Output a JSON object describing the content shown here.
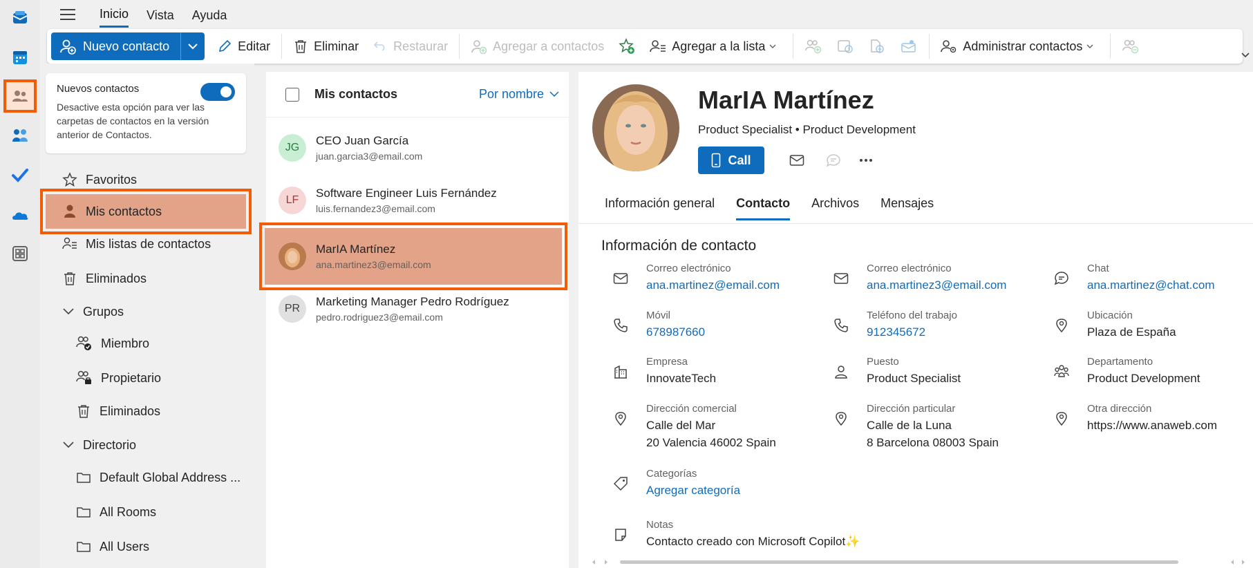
{
  "rail": {
    "items": [
      {
        "name": "mail-icon"
      },
      {
        "name": "calendar-icon"
      },
      {
        "name": "people-icon"
      },
      {
        "name": "groups-icon"
      },
      {
        "name": "todo-icon"
      },
      {
        "name": "onedrive-icon"
      },
      {
        "name": "apps-icon"
      }
    ]
  },
  "menu": {
    "tabs": [
      "Inicio",
      "Vista",
      "Ayuda"
    ],
    "active": "Inicio"
  },
  "toolbar": {
    "new_contact": "Nuevo contacto",
    "edit": "Editar",
    "delete": "Eliminar",
    "restore": "Restaurar",
    "add_to_contacts": "Agregar a contactos",
    "add_to_list": "Agregar a la lista",
    "manage_contacts": "Administrar contactos"
  },
  "leftnav": {
    "toggle_title": "Nuevos contactos",
    "toggle_desc": "Desactive esta opción para ver las carpetas de contactos en la versión anterior de Contactos.",
    "toggle_on": true,
    "favorites": "Favoritos",
    "my_contacts": "Mis contactos",
    "my_lists": "Mis listas de contactos",
    "deleted": "Eliminados",
    "groups": "Grupos",
    "member": "Miembro",
    "owner": "Propietario",
    "groups_deleted": "Eliminados",
    "directory": "Directorio",
    "dir_global": "Default Global Address ...",
    "dir_rooms": "All Rooms",
    "dir_users": "All Users"
  },
  "list": {
    "title": "Mis contactos",
    "sort": "Por nombre",
    "contacts": [
      {
        "initials": "JG",
        "name": "CEO Juan García",
        "email": "juan.garcia3@email.com",
        "bg": "#c8efd4",
        "fg": "#2f7a45"
      },
      {
        "initials": "LF",
        "name": "Software Engineer Luis Fernández",
        "email": "luis.fernandez3@email.com",
        "bg": "#f7d6d6",
        "fg": "#a33a3a"
      },
      {
        "initials": "",
        "name": "MarIA Martínez",
        "email": "ana.martinez3@email.com",
        "bg": "#c98b5e",
        "fg": "#fff"
      },
      {
        "initials": "PR",
        "name": "Marketing Manager Pedro Rodríguez",
        "email": "pedro.rodriguez3@email.com",
        "bg": "#e0e0e0",
        "fg": "#424242"
      }
    ]
  },
  "detail": {
    "name": "MarIA Martínez",
    "subtitle": "Product Specialist • Product Development",
    "call": "Call",
    "tabs": [
      "Información general",
      "Contacto",
      "Archivos",
      "Mensajes"
    ],
    "active_tab": "Contacto",
    "section_title": "Información de contacto",
    "fields": {
      "email1_label": "Correo electrónico",
      "email1": "ana.martinez@email.com",
      "email2_label": "Correo electrónico",
      "email2": "ana.martinez3@email.com",
      "chat_label": "Chat",
      "chat": "ana.martinez@chat.com",
      "mobile_label": "Móvil",
      "mobile": "678987660",
      "work_phone_label": "Teléfono del trabajo",
      "work_phone": "912345672",
      "location_label": "Ubicación",
      "location": "Plaza de España",
      "company_label": "Empresa",
      "company": "InnovateTech",
      "position_label": "Puesto",
      "position": "Product Specialist",
      "department_label": "Departamento",
      "department": "Product Development",
      "business_addr_label": "Dirección comercial",
      "business_addr_1": "Calle del Mar",
      "business_addr_2": "20 Valencia 46002 Spain",
      "home_addr_label": "Dirección particular",
      "home_addr_1": "Calle de la Luna",
      "home_addr_2": "8 Barcelona 08003 Spain",
      "other_addr_label": "Otra dirección",
      "other_addr": "https://www.anaweb.com",
      "categories_label": "Categorías",
      "categories": "Agregar categoría",
      "notes_label": "Notas",
      "notes": "Contacto creado con Microsoft Copilot✨"
    }
  },
  "colors": {
    "accent": "#0f6cbd",
    "highlight": "#f25c05"
  }
}
